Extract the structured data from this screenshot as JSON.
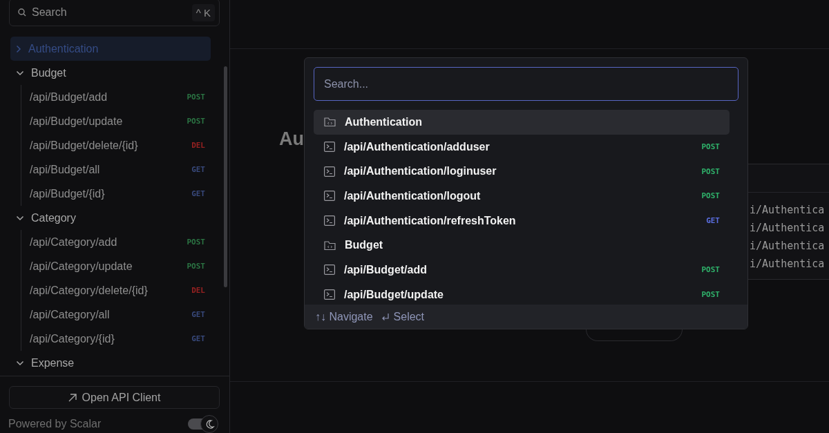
{
  "sidebar": {
    "search": {
      "placeholder": "Search",
      "shortcut": "^ K"
    },
    "tree": [
      {
        "label": "Authentication",
        "expanded": false,
        "selected": true
      },
      {
        "label": "Budget",
        "expanded": true,
        "selected": false,
        "children": [
          {
            "label": "/api/Budget/add",
            "method": "POST"
          },
          {
            "label": "/api/Budget/update",
            "method": "POST"
          },
          {
            "label": "/api/Budget/delete/{id}",
            "method": "DEL"
          },
          {
            "label": "/api/Budget/all",
            "method": "GET"
          },
          {
            "label": "/api/Budget/{id}",
            "method": "GET"
          }
        ]
      },
      {
        "label": "Category",
        "expanded": true,
        "selected": false,
        "children": [
          {
            "label": "/api/Category/add",
            "method": "POST"
          },
          {
            "label": "/api/Category/update",
            "method": "POST"
          },
          {
            "label": "/api/Category/delete/{id}",
            "method": "DEL"
          },
          {
            "label": "/api/Category/all",
            "method": "GET"
          },
          {
            "label": "/api/Category/{id}",
            "method": "GET"
          }
        ]
      },
      {
        "label": "Expense",
        "expanded": true,
        "selected": false
      }
    ],
    "client_button": "Open API Client",
    "powered_by": "Powered by Scalar",
    "dark_mode": {
      "on": true
    }
  },
  "main": {
    "heading": "Au",
    "code_lines": [
      "i/Authentica",
      "i/Authentica",
      "i/Authentica",
      "i/Authentica"
    ]
  },
  "modal": {
    "search": {
      "placeholder": "Search..."
    },
    "results": [
      {
        "kind": "folder",
        "label": "Authentication",
        "selected": true
      },
      {
        "kind": "endpoint",
        "label": "/api/Authentication/adduser",
        "method": "POST",
        "selected": false
      },
      {
        "kind": "endpoint",
        "label": "/api/Authentication/loginuser",
        "method": "POST",
        "selected": false
      },
      {
        "kind": "endpoint",
        "label": "/api/Authentication/logout",
        "method": "POST",
        "selected": false
      },
      {
        "kind": "endpoint",
        "label": "/api/Authentication/refreshToken",
        "method": "GET",
        "selected": false
      },
      {
        "kind": "folder",
        "label": "Budget",
        "selected": false
      },
      {
        "kind": "endpoint",
        "label": "/api/Budget/add",
        "method": "POST",
        "selected": false
      },
      {
        "kind": "endpoint",
        "label": "/api/Budget/update",
        "method": "POST",
        "selected": false
      }
    ],
    "hints": [
      {
        "kind": "navigate",
        "keys": "↑↓",
        "label": "Navigate"
      },
      {
        "kind": "select",
        "label": "Select"
      }
    ]
  }
}
